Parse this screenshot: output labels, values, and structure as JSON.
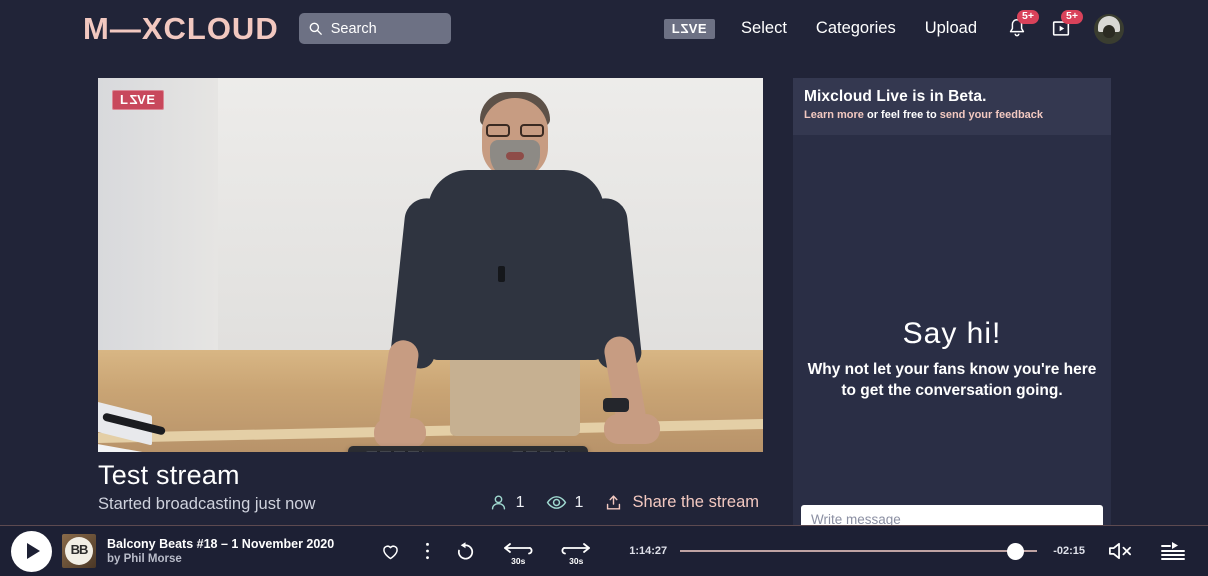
{
  "header": {
    "logo": "M—XCLOUD",
    "search": {
      "placeholder": "Search",
      "icon": "search-icon"
    },
    "live_chip": "LIVE",
    "nav": [
      {
        "label": "Select"
      },
      {
        "label": "Categories"
      },
      {
        "label": "Upload"
      }
    ],
    "notifications": {
      "icon": "bell-icon",
      "badge": "5+"
    },
    "uploads": {
      "icon": "video-box-icon",
      "badge": "5+"
    },
    "avatar": "user-avatar"
  },
  "video": {
    "live_badge": "LIVE",
    "title": "Test stream",
    "subtitle": "Started broadcasting just now"
  },
  "stats": {
    "listeners": {
      "icon": "person-icon",
      "value": "1"
    },
    "views": {
      "icon": "eye-icon",
      "value": "1"
    },
    "share": {
      "icon": "share-upload-icon",
      "label": "Share the stream"
    }
  },
  "chat": {
    "beta": {
      "title": "Mixcloud Live is in Beta.",
      "learn_more": "Learn more",
      "middle": " or feel free to ",
      "feedback": "send your feedback"
    },
    "empty_state": {
      "title": "Say hi!",
      "body": "Why not let your fans know you're here to get the conversation going."
    },
    "input_placeholder": "Write message"
  },
  "player": {
    "play_icon": "play-icon",
    "thumbnail_label": "BB",
    "track_title": "Balcony Beats #18 – 1 November 2020",
    "track_artist": "by Phil Morse",
    "favorite_icon": "heart-icon",
    "more_icon": "more-vertical-icon",
    "replay_icon": "replay-icon",
    "rewind": {
      "icon": "rewind-icon",
      "label": "30s"
    },
    "forward": {
      "icon": "forward-icon",
      "label": "30s"
    },
    "elapsed": "1:14:27",
    "remaining": "-02:15",
    "mute_icon": "speaker-muted-icon",
    "queue_icon": "queue-icon"
  },
  "colors": {
    "background": "#212438",
    "panel": "#2a2e45",
    "beta_banner": "#343850",
    "accent_pink": "#f2c8c0",
    "badge_red": "#d9425a",
    "live_red": "#c8485c",
    "player_bar": "#1d2034",
    "stat_teal": "#9fd8cf"
  }
}
